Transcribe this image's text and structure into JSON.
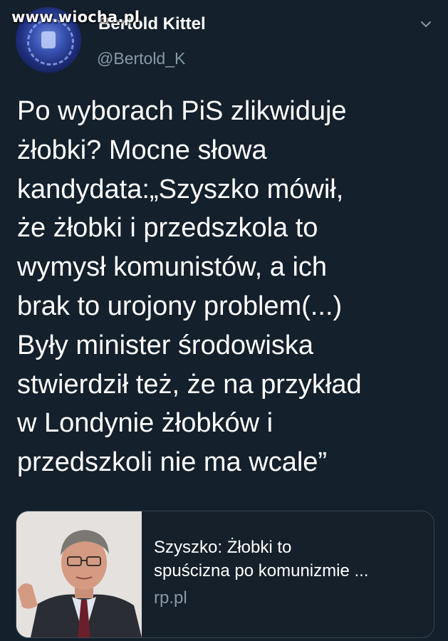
{
  "watermark": "www.wiocha.pl",
  "author": {
    "display_name": "Bertold Kittel",
    "handle": "@Bertold_K"
  },
  "tweet": {
    "lines": [
      "Po wyborach PiS zlikwiduje",
      "żłobki? Mocne słowa",
      "kandydata:„Szyszko mówił,",
      "że żłobki i przedszkola to",
      "wymysł komunistów, a ich",
      "brak to urojony problem(...)",
      "Były minister środowiska",
      "stwierdził też, że na przykład",
      "w Londynie żłobków i",
      "przedszkoli nie ma wcale”"
    ]
  },
  "link_card": {
    "title_lines": [
      "Szyszko: Żłobki to",
      "spuścizna po komunizmie ..."
    ],
    "domain": "rp.pl",
    "thumbnail_icon": "person-photo"
  },
  "icons": {
    "menu": "chevron-down-icon",
    "avatar": "avatar-image"
  },
  "colors": {
    "background": "#15202b",
    "text": "#ffffff",
    "secondary_text": "#8899a6",
    "border": "#38444d"
  }
}
